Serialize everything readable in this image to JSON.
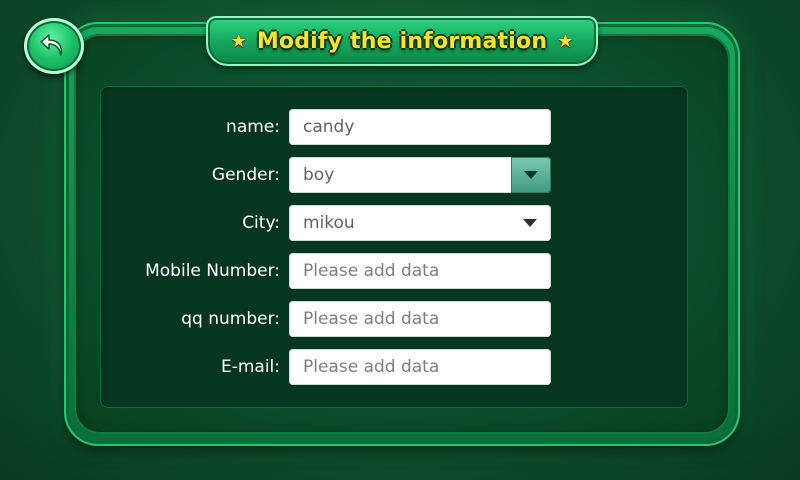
{
  "header": {
    "title": "Modify the information",
    "star_left": "★",
    "star_right": "★",
    "back_icon": "back-arrow-icon"
  },
  "form": {
    "name": {
      "label": "name:",
      "value": "candy"
    },
    "gender": {
      "label": "Gender:",
      "value": "boy"
    },
    "city": {
      "label": "City:",
      "value": "mikou"
    },
    "mobile": {
      "label": "Mobile Number:",
      "placeholder": "Please add data"
    },
    "qq": {
      "label": "qq number:",
      "placeholder": "Please add data"
    },
    "email": {
      "label": "E-mail:",
      "placeholder": "Please add data"
    }
  },
  "colors": {
    "title_text": "#ffe22b",
    "panel_green": "#108a4b",
    "content_bg": "#073620",
    "dropdown_button": "#3f9a80"
  }
}
